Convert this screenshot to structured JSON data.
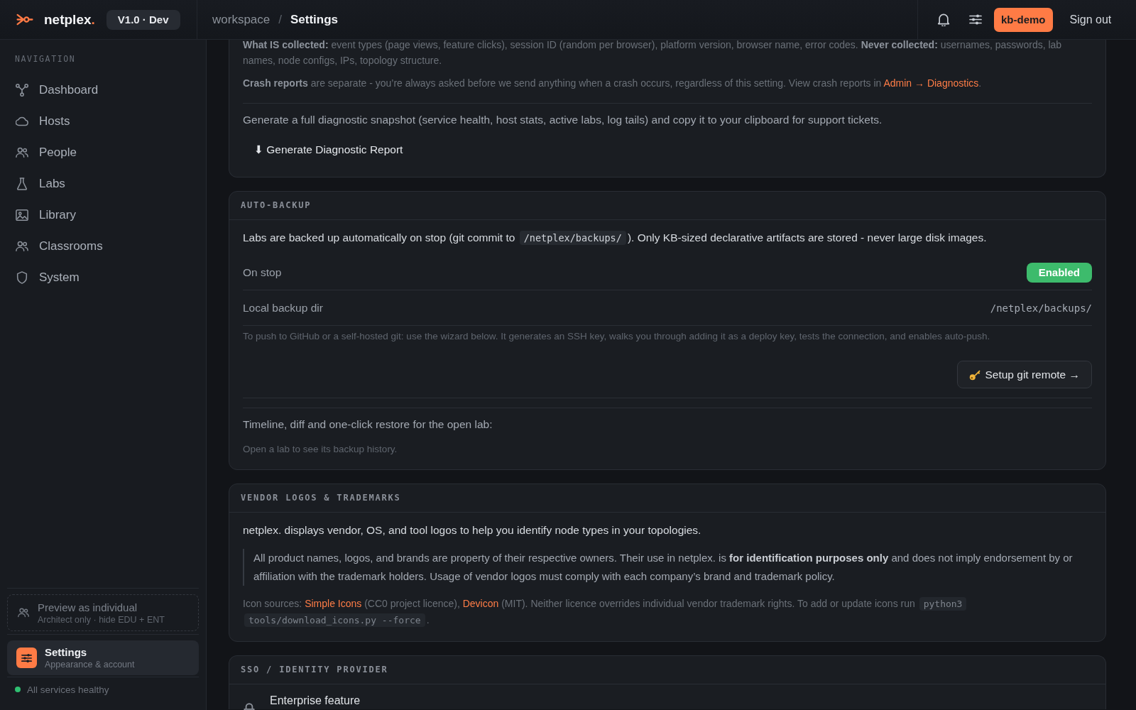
{
  "topbar": {
    "brand": {
      "name": "netplex",
      "dot": "."
    },
    "version_badge": "V1.0 · Dev",
    "breadcrumb": {
      "parent": "workspace",
      "separator": "/",
      "current": "Settings"
    },
    "user_button": "kb-demo",
    "sign_out": "Sign out"
  },
  "sidebar": {
    "heading": "NAVIGATION",
    "items": [
      {
        "label": "Dashboard",
        "selected": false
      },
      {
        "label": "Hosts",
        "selected": false
      },
      {
        "label": "People",
        "selected": false
      },
      {
        "label": "Labs",
        "selected": false
      },
      {
        "label": "Library",
        "selected": false
      },
      {
        "label": "Classrooms",
        "selected": false
      },
      {
        "label": "System",
        "selected": false
      }
    ],
    "preview": {
      "title": "Preview as individual",
      "subtitle": "Architect only · hide EDU + ENT"
    },
    "settings": {
      "title": "Settings",
      "subtitle": "Appearance & account",
      "selected": true
    },
    "status": {
      "text": "All services healthy",
      "healthy": true
    }
  },
  "sections": [
    {
      "blocks": [
        {
          "kind": "note",
          "parts": [
            {
              "kind": "text",
              "text": "**What IS collected:** event types (page views, feature clicks), session ID (random per browser), platform version, browser name, error codes. **Never collected:** usernames, passwords, lab names, node configs, IPs, topology structure."
            }
          ]
        },
        {
          "kind": "note",
          "parts": [
            {
              "kind": "text",
              "text": "**Crash reports** are separate - you’re always asked before we send anything when a crash occurs, regardless of this setting. View crash reports in "
            },
            {
              "kind": "link",
              "text": "Admin → Diagnostics"
            },
            {
              "kind": "text",
              "text": "."
            }
          ]
        },
        {
          "kind": "divider"
        },
        {
          "kind": "body",
          "parts": [
            {
              "kind": "text",
              "text": "Generate a full diagnostic snapshot (service health, host stats, active labs, log tails) and copy it to your clipboard for support tickets."
            }
          ]
        },
        {
          "kind": "ghost_button",
          "label": "⬇ Generate Diagnostic Report"
        }
      ]
    },
    {
      "title": "AUTO-BACKUP",
      "blocks": [
        {
          "kind": "lead",
          "parts": [
            {
              "kind": "text",
              "text": "Labs are backed up automatically on stop (git commit to "
            },
            {
              "kind": "code",
              "text": "/netplex/backups/"
            },
            {
              "kind": "text",
              "text": "). Only KB-sized declarative artifacts are stored - never large disk images."
            }
          ]
        },
        {
          "kind": "row",
          "label": "On stop",
          "control": {
            "kind": "toggle",
            "text": "Enabled",
            "on": true
          }
        },
        {
          "kind": "row",
          "label": "Local backup dir",
          "control": {
            "kind": "path",
            "text": "/netplex/backups/"
          }
        },
        {
          "kind": "hint",
          "parts": [
            {
              "kind": "text",
              "text": "To push to GitHub or a self-hosted git: use the wizard below. It generates an SSH key, walks you through adding it as a deploy key, tests the connection, and enables auto-push."
            }
          ]
        },
        {
          "kind": "button",
          "label": "Setup git remote →"
        },
        {
          "kind": "divider"
        },
        {
          "kind": "divider"
        },
        {
          "kind": "body",
          "parts": [
            {
              "kind": "text",
              "text": "Timeline, diff and one-click restore for the open lab:"
            }
          ]
        },
        {
          "kind": "hint",
          "parts": [
            {
              "kind": "text",
              "text": "Open a lab to see its backup history."
            }
          ]
        }
      ]
    },
    {
      "title": "VENDOR LOGOS & TRADEMARKS",
      "blocks": [
        {
          "kind": "lead",
          "parts": [
            {
              "kind": "text",
              "text": "netplex. displays vendor, OS, and tool logos to help you identify node types in your topologies."
            }
          ]
        },
        {
          "kind": "quote",
          "parts": [
            {
              "kind": "text",
              "text": "All product names, logos, and brands are property of their respective owners. Their use in netplex. is **for identification purposes only** and does not imply endorsement by or affiliation with the trademark holders. Usage of vendor logos must comply with each company’s brand and trademark policy."
            }
          ]
        },
        {
          "kind": "note",
          "parts": [
            {
              "kind": "text",
              "text": "Icon sources: "
            },
            {
              "kind": "link",
              "text": "Simple Icons"
            },
            {
              "kind": "text",
              "text": " (CC0 project licence), "
            },
            {
              "kind": "link",
              "text": "Devicon"
            },
            {
              "kind": "text",
              "text": " (MIT). Neither licence overrides individual vendor trademark rights. To add or update icons run "
            },
            {
              "kind": "code",
              "text": "python3 tools/download_icons.py --force"
            },
            {
              "kind": "text",
              "text": "."
            }
          ]
        }
      ]
    },
    {
      "title": "SSO / IDENTITY PROVIDER",
      "blocks": [
        {
          "kind": "feature",
          "text": "Enterprise feature"
        }
      ]
    }
  ]
}
